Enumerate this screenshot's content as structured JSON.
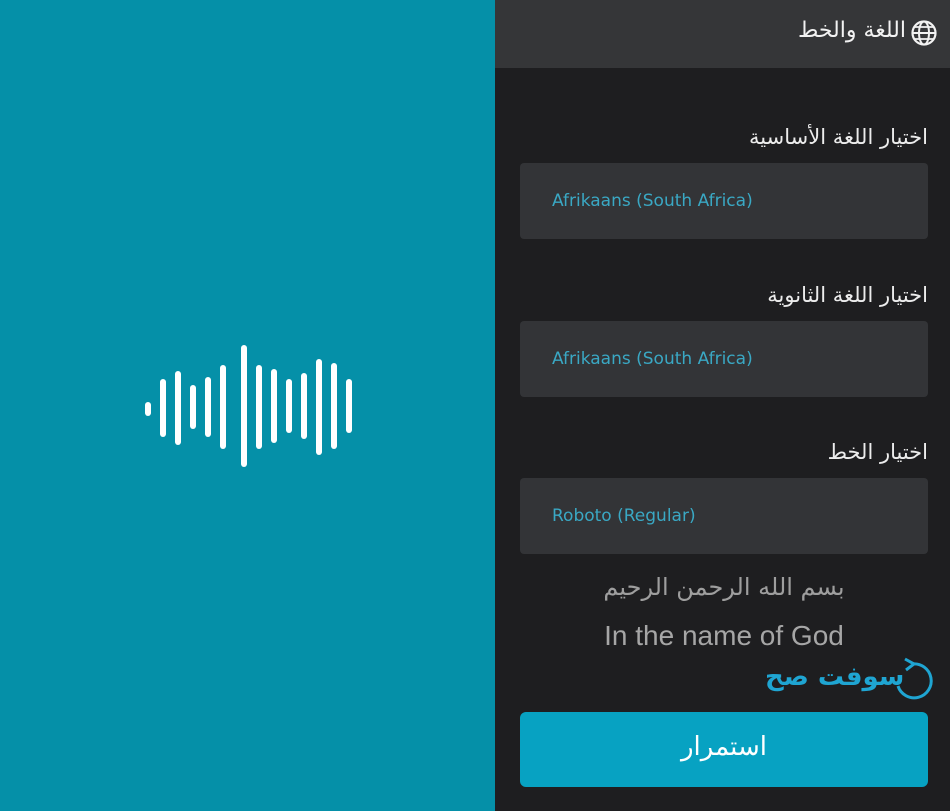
{
  "brand": {
    "teal": "#0590a8",
    "accent_text": "#3aa8c4",
    "button": "#07a2c2",
    "dark_bg": "#1e1e20"
  },
  "splash": {
    "icon": "audio-waveform-icon"
  },
  "header": {
    "title": "اللغة والخط",
    "icon": "globe-icon"
  },
  "settings": {
    "primary_language": {
      "label": "اختيار اللغة الأساسية",
      "value": "Afrikaans (South Africa)"
    },
    "secondary_language": {
      "label": "اختيار اللغة الثانوية",
      "value": "Afrikaans (South Africa)"
    },
    "font": {
      "label": "اختيار الخط",
      "value": "Roboto (Regular)"
    }
  },
  "preview": {
    "arabic": "بسم الله الرحمن الرحيم",
    "english": "In the name of God"
  },
  "watermark": {
    "text": "سوفت صح"
  },
  "actions": {
    "continue_label": "استمرار"
  }
}
